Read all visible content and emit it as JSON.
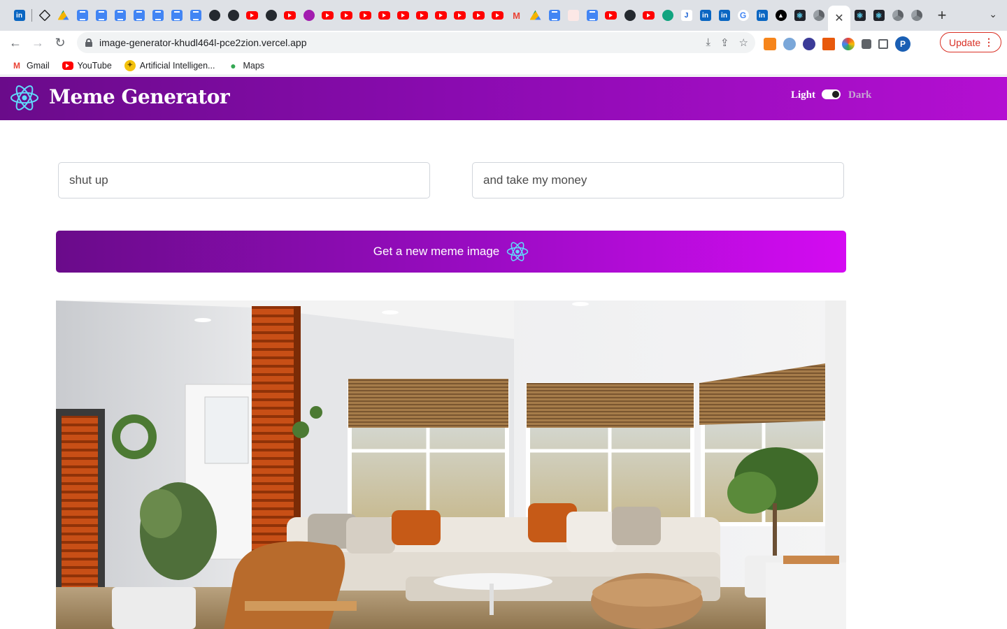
{
  "browser": {
    "url": "image-generator-khudl464l-pce2zion.vercel.app",
    "update_label": "Update",
    "profile_initial": "P",
    "active_tab_close": "✕",
    "bookmarks": [
      {
        "label": "Gmail",
        "icon": "gmail-icon"
      },
      {
        "label": "YouTube",
        "icon": "youtube-icon"
      },
      {
        "label": "Artificial Intelligen...",
        "icon": "ai-icon"
      },
      {
        "label": "Maps",
        "icon": "maps-icon"
      }
    ]
  },
  "app": {
    "title": "Meme Generator",
    "mode_light": "Light",
    "mode_dark": "Dark",
    "top_text": "shut up",
    "bottom_text": "and take my money",
    "button_label": "Get a new meme image",
    "colors": {
      "header_start": "#6a0b8a",
      "header_end": "#b40fd2",
      "button_end": "#d40bf2",
      "react_blue": "#61dafb"
    }
  }
}
